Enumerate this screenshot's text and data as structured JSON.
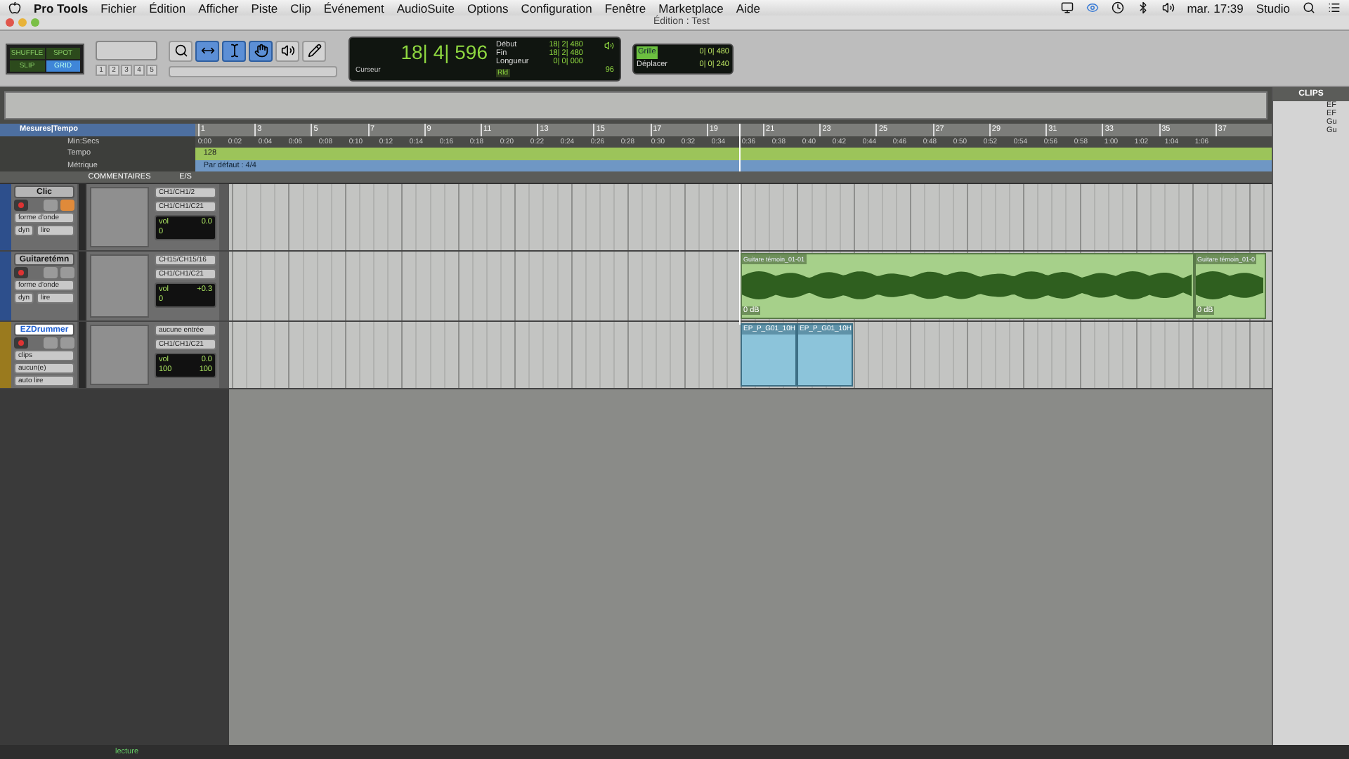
{
  "menubar": {
    "app": "Pro Tools",
    "menus": [
      "Fichier",
      "Édition",
      "Afficher",
      "Piste",
      "Clip",
      "Événement",
      "AudioSuite",
      "Options",
      "Configuration",
      "Fenêtre",
      "Marketplace",
      "Aide"
    ],
    "clock": "mar. 17:39",
    "user": "Studio"
  },
  "window": {
    "title": "Édition : Test"
  },
  "edit_modes": [
    {
      "label": "SHUFFLE",
      "selected": false
    },
    {
      "label": "SPOT",
      "selected": false
    },
    {
      "label": "SLIP",
      "selected": false
    },
    {
      "label": "GRID",
      "selected": true
    }
  ],
  "zoom_presets": [
    "1",
    "2",
    "3",
    "4",
    "5"
  ],
  "tools": [
    {
      "kind": "zoom",
      "selected": false
    },
    {
      "kind": "trim",
      "selected": true
    },
    {
      "kind": "select",
      "selected": true
    },
    {
      "kind": "grab",
      "selected": true
    },
    {
      "kind": "scrub",
      "selected": false
    },
    {
      "kind": "pencil",
      "selected": false
    }
  ],
  "counter": {
    "main": "18| 4| 596",
    "label": "Curseur",
    "rows": [
      {
        "label": "Début",
        "value": "18| 2| 480"
      },
      {
        "label": "Fin",
        "value": "18| 2| 480"
      },
      {
        "label": "Longueur",
        "value": "0| 0| 000"
      }
    ],
    "rld": "Rld",
    "nudge": "96"
  },
  "grid": {
    "grid_label": "Grille",
    "grid_value": "0| 0| 480",
    "nudge_label": "Déplacer",
    "nudge_value": "0| 0| 240"
  },
  "rulers": {
    "labels": [
      "Mesures|Tempo",
      "Min:Secs",
      "Tempo",
      "Métrique"
    ],
    "bars": [
      "1",
      "3",
      "5",
      "7",
      "9",
      "11",
      "13",
      "15",
      "17",
      "19",
      "21",
      "23",
      "25",
      "27",
      "29",
      "31",
      "33",
      "35",
      "37"
    ],
    "times": [
      "0:00",
      "0:02",
      "0:04",
      "0:06",
      "0:08",
      "0:10",
      "0:12",
      "0:14",
      "0:16",
      "0:18",
      "0:20",
      "0:22",
      "0:24",
      "0:26",
      "0:28",
      "0:30",
      "0:32",
      "0:34",
      "0:36",
      "0:38",
      "0:40",
      "0:42",
      "0:44",
      "0:46",
      "0:48",
      "0:50",
      "0:52",
      "0:54",
      "0:56",
      "0:58",
      "1:00",
      "1:02",
      "1:04",
      "1:06"
    ],
    "tempo": "128",
    "meter": "Par défaut : 4/4"
  },
  "track_header": {
    "comments": "COMMENTAIRES",
    "io": "E/S"
  },
  "tracks": [
    {
      "name": "Clic",
      "selected": false,
      "color": "#2d4f8c",
      "solo": false,
      "mute": true,
      "view_controls": [
        [
          "forme d'onde"
        ],
        [
          "dyn",
          "lire"
        ]
      ],
      "io": [
        "CH1/CH1/2",
        "CH1/CH1/C21"
      ],
      "vol_label": "vol",
      "vol": "0.0",
      "pan": [
        "0"
      ]
    },
    {
      "name": "Guitaretémn",
      "selected": false,
      "color": "#2d4f8c",
      "solo": false,
      "mute": false,
      "view_controls": [
        [
          "forme d'onde"
        ],
        [
          "dyn",
          "lire"
        ]
      ],
      "io": [
        "CH15/CH15/16",
        "CH1/CH1/C21"
      ],
      "vol_label": "vol",
      "vol": "+0.3",
      "pan": [
        "0"
      ],
      "clips": [
        {
          "kind": "audio",
          "name": "Guitare témoin_01-01",
          "gain": "0 dB"
        },
        {
          "kind": "audio",
          "name": "Guitare témoin_01-0",
          "gain": "0 dB"
        }
      ]
    },
    {
      "name": "EZDrummer",
      "selected": true,
      "color": "#9a7a1e",
      "solo": false,
      "mute": false,
      "view_controls": [
        [
          "clips"
        ],
        [
          "aucun(e)"
        ],
        [
          "auto lire"
        ]
      ],
      "io": [
        "aucune entrée",
        "CH1/CH1/C21"
      ],
      "vol_label": "vol",
      "vol": "0.0",
      "pan": [
        "100",
        "100"
      ],
      "clips": [
        {
          "kind": "midi",
          "name": "EP_P_G01_10H"
        },
        {
          "kind": "midi",
          "name": "EP_P_G01_10H"
        }
      ]
    }
  ],
  "clips_panel": {
    "title": "CLIPS",
    "items": [
      "EF",
      "EF",
      "Gu",
      "Gu"
    ]
  },
  "status": "lecture"
}
